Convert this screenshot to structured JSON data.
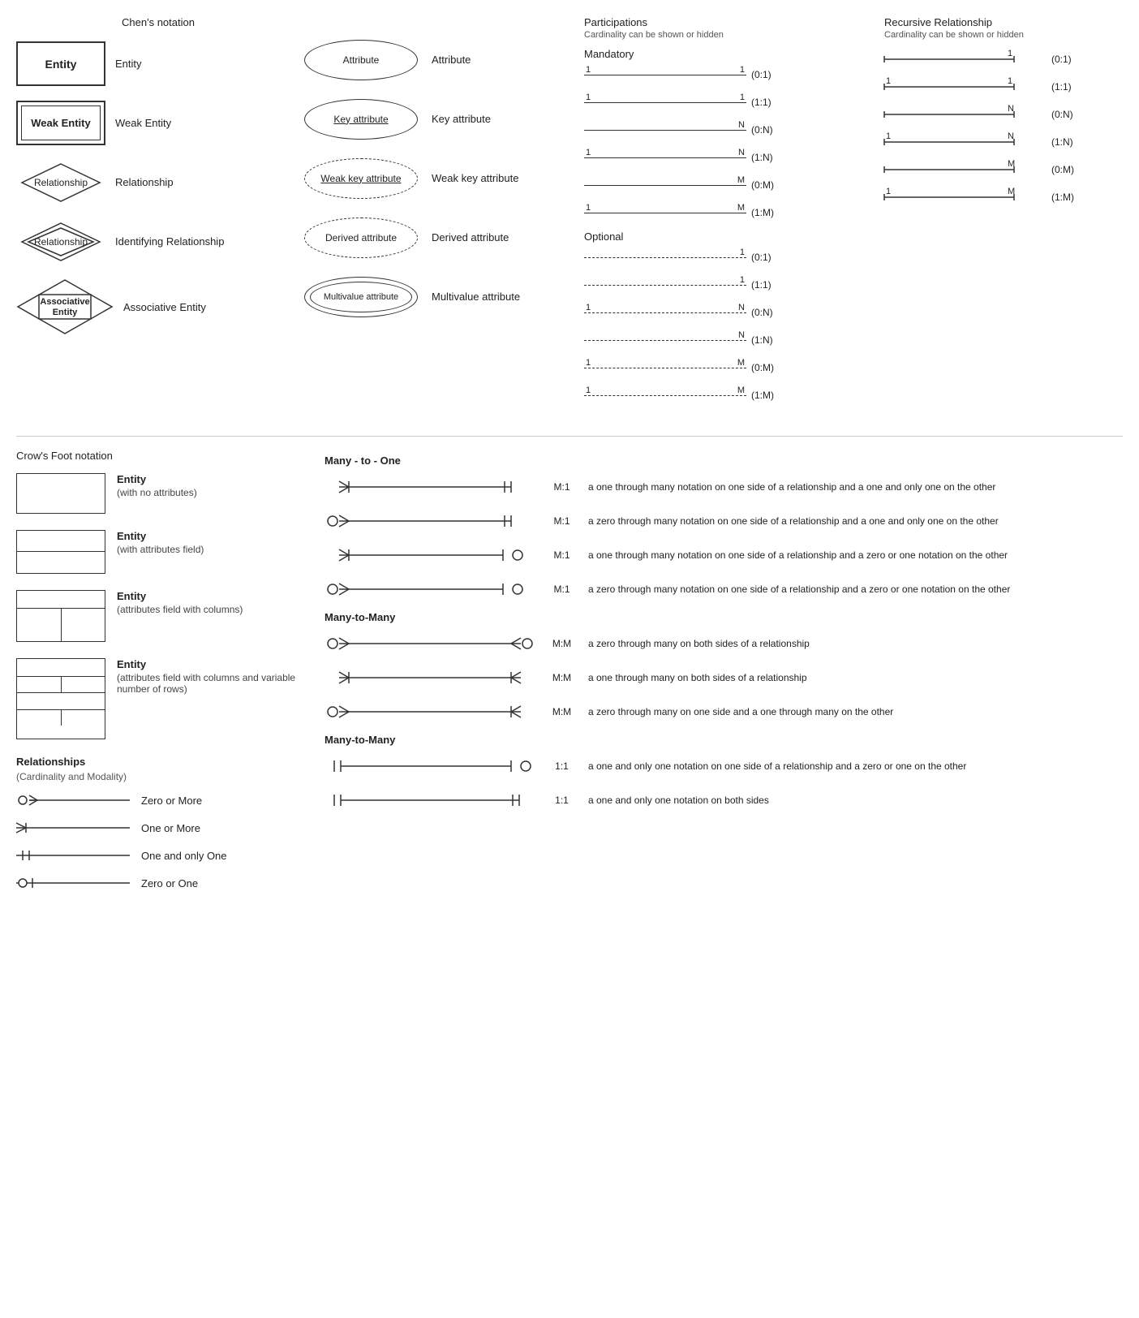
{
  "chens": {
    "title": "Chen's notation",
    "items": [
      {
        "shape": "entity",
        "label": "Entity",
        "desc": "Entity"
      },
      {
        "shape": "weak-entity",
        "label": "Weak Entity",
        "desc": "Weak Entity"
      },
      {
        "shape": "diamond",
        "label": "Relationship",
        "desc": "Relationship"
      },
      {
        "shape": "diamond-double",
        "label": "Relationship",
        "desc": "Identifying Relationship"
      },
      {
        "shape": "assoc-entity",
        "label": "Associative\nEntity",
        "desc": "Associative Entity"
      }
    ]
  },
  "attributes": {
    "items": [
      {
        "shape": "ellipse",
        "label": "Attribute",
        "desc": "Attribute"
      },
      {
        "shape": "ellipse-underline",
        "label": "Key attribute",
        "desc": "Key attribute"
      },
      {
        "shape": "ellipse-underline-dashed",
        "label": "Weak key attribute",
        "desc": "Weak key attribute"
      },
      {
        "shape": "ellipse-dashed",
        "label": "Derived attribute",
        "desc": "Derived attribute"
      },
      {
        "shape": "ellipse-double",
        "label": "Multivalue attribute",
        "desc": "Multivalue attribute"
      }
    ]
  },
  "participations": {
    "title": "Participations",
    "subtitle": "Cardinality can be shown or hidden",
    "mandatory_label": "Mandatory",
    "optional_label": "Optional",
    "mandatory_rows": [
      {
        "left": "1",
        "right": "1",
        "notation": "(0:1)"
      },
      {
        "left": "1",
        "right": "1",
        "notation": "(1:1)"
      },
      {
        "left": "",
        "right": "N",
        "notation": "(0:N)"
      },
      {
        "left": "1",
        "right": "N",
        "notation": "(1:N)"
      },
      {
        "left": "",
        "right": "M",
        "notation": "(0:M)"
      },
      {
        "left": "1",
        "right": "M",
        "notation": "(1:M)"
      }
    ],
    "optional_rows": [
      {
        "left": "",
        "right": "1",
        "notation": "(0:1)",
        "dashed": true
      },
      {
        "left": "",
        "right": "1",
        "notation": "(1:1)",
        "dashed": true
      },
      {
        "left": "1",
        "right": "N",
        "notation": "(0:N)",
        "dashed": true
      },
      {
        "left": "",
        "right": "N",
        "notation": "(1:N)",
        "dashed": true
      },
      {
        "left": "1",
        "right": "M",
        "notation": "(0:M)",
        "dashed": true
      },
      {
        "left": "1",
        "right": "M",
        "notation": "(1:M)",
        "dashed": true
      }
    ]
  },
  "recursive": {
    "title": "Recursive Relationship",
    "subtitle": "Cardinality can be shown or hidden",
    "rows": [
      {
        "left": "",
        "right": "1",
        "notation": "(0:1)"
      },
      {
        "left": "1",
        "right": "1",
        "notation": "(1:1)"
      },
      {
        "left": "",
        "right": "N",
        "notation": "(0:N)"
      },
      {
        "left": "1",
        "right": "N",
        "notation": "(1:N)"
      },
      {
        "left": "",
        "right": "M",
        "notation": "(0:M)"
      },
      {
        "left": "1",
        "right": "M",
        "notation": "(1:M)"
      }
    ]
  },
  "crows": {
    "title": "Crow's Foot notation",
    "entities": [
      {
        "type": "simple",
        "label": "Entity",
        "sublabel": "(with no attributes)"
      },
      {
        "type": "attrs",
        "label": "Entity",
        "sublabel": "(with attributes field)"
      },
      {
        "type": "cols",
        "label": "Entity",
        "sublabel": "(attributes field with columns)"
      },
      {
        "type": "variable",
        "label": "Entity",
        "sublabel": "(attributes field with columns and variable number of rows)"
      }
    ],
    "many_to_one_title": "Many - to - One",
    "many_to_one_rows": [
      {
        "label": "M:1",
        "desc": "a one through many notation on one side of a relationship and a one and only one on the other",
        "left": "many-mandatory",
        "right": "one-mandatory"
      },
      {
        "label": "M:1",
        "desc": "a zero through many notation on one side of a relationship and a one and only one on the other",
        "left": "many-optional",
        "right": "one-mandatory"
      },
      {
        "label": "M:1",
        "desc": "a one through many notation on one side of a relationship and a zero or one notation on the other",
        "left": "many-mandatory",
        "right": "one-optional"
      },
      {
        "label": "M:1",
        "desc": "a zero through many notation on one side of a relationship and a zero or one notation on the other",
        "left": "many-optional",
        "right": "one-optional"
      }
    ],
    "many_to_many_title": "Many-to-Many",
    "many_to_many_rows": [
      {
        "label": "M:M",
        "desc": "a zero through many on both sides of a relationship",
        "left": "many-optional",
        "right": "many-optional-r"
      },
      {
        "label": "M:M",
        "desc": "a one through many on both sides of a relationship",
        "left": "many-mandatory",
        "right": "many-mandatory-r"
      },
      {
        "label": "M:M",
        "desc": "a zero through many on one side and a one through many on the other",
        "left": "many-optional",
        "right": "many-mandatory-r"
      }
    ],
    "one_to_one_title": "Many-to-Many",
    "one_to_one_rows": [
      {
        "label": "1:1",
        "desc": "a one and only one notation on one side of a relationship and a zero or one on the other",
        "left": "one-mandatory",
        "right": "one-optional"
      },
      {
        "label": "1:1",
        "desc": "a one and only one notation on both sides",
        "left": "one-mandatory",
        "right": "one-mandatory-r"
      }
    ]
  },
  "relationships_legend": {
    "title": "Relationships",
    "subtitle": "(Cardinality and Modality)",
    "items": [
      {
        "type": "zero-or-more",
        "label": "Zero or More"
      },
      {
        "type": "one-or-more",
        "label": "One or More"
      },
      {
        "type": "one-only",
        "label": "One and only One"
      },
      {
        "type": "zero-or-one",
        "label": "Zero or One"
      }
    ]
  }
}
